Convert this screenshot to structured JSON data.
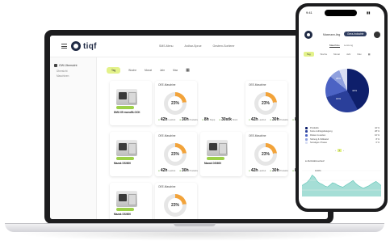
{
  "laptop": {
    "brand": "tiqf",
    "nav": [
      "SMS-Menu",
      "Ardhar-Sprue",
      "Gestern-Sortierer"
    ],
    "language": "DE",
    "sidebar": {
      "section": "GW-Übersicht",
      "items": [
        "Übersicht",
        "Maschinen"
      ]
    },
    "filters": [
      "Tag",
      "Woche",
      "Monat",
      "Jahr",
      "Max"
    ],
    "active_filter": "Tag",
    "cards": [
      {
        "kind": "machine",
        "title": "",
        "name": "DMU 65 monoBLOCK"
      },
      {
        "kind": "oee",
        "title": "OEE-Maschine",
        "percent": "23%",
        "name": "Mazak DS/600",
        "stats": [
          {
            "value": "42h",
            "unit": "Laufzeit"
          },
          {
            "value": "30h",
            "unit": "Produktiv"
          },
          {
            "value": "8h",
            "unit": "Stopp"
          },
          {
            "value": "30stk",
            "unit": "Stück"
          }
        ]
      },
      {
        "kind": "oee",
        "title": "OEE-Maschine",
        "percent": "23%",
        "name": "Mazak DS/600",
        "stats": [
          {
            "value": "42h",
            "unit": "Laufzeit"
          },
          {
            "value": "30h",
            "unit": "Produktiv"
          },
          {
            "value": "8h",
            "unit": "Stopp"
          },
          {
            "value": "30stk",
            "unit": "Stück"
          }
        ]
      },
      {
        "kind": "machine",
        "title": "",
        "name": "Mazak DS/600"
      },
      {
        "kind": "oee",
        "title": "OEE-Maschine",
        "percent": "23%",
        "name": "",
        "stats": [
          {
            "value": "42h",
            "unit": "Laufzeit"
          },
          {
            "value": "30h",
            "unit": "Produktiv"
          },
          {
            "value": "8h",
            "unit": "Stopp"
          },
          {
            "value": "30stk",
            "unit": "Stück"
          }
        ]
      },
      {
        "kind": "machine",
        "title": "",
        "name": "Mazak DS/600"
      },
      {
        "kind": "oee",
        "title": "OEE-Maschine",
        "percent": "23%",
        "name": "",
        "stats": [
          {
            "value": "42h",
            "unit": "Laufzeit"
          },
          {
            "value": "30h",
            "unit": "Produktiv"
          },
          {
            "value": "8h",
            "unit": "Stopp"
          },
          {
            "value": "30stk",
            "unit": "Stück"
          }
        ]
      },
      {
        "kind": "machine",
        "title": "",
        "name": "Mazak DS/600"
      },
      {
        "kind": "oee",
        "title": "OEE-Maschine",
        "percent": "23%",
        "name": "",
        "stats": []
      }
    ],
    "donut_level": 0.23,
    "colors": {
      "accent": "#e3f28a",
      "status_green": "#9dd14a",
      "donut_orange": "#f2a33a",
      "donut_track": "#e6e6e6",
      "navy": "#1f2a44"
    }
  },
  "phone": {
    "time": "9:41",
    "user": "Maxmann-ling",
    "pill": "Gera-Industrie",
    "tabs": [
      "Maschine",
      "Leistung"
    ],
    "active_tab": "Maschine",
    "filters": [
      "Tag",
      "Woche",
      "Monat",
      "Jahr",
      "Max"
    ],
    "active_filter": "Tag",
    "pie": {
      "slices": [
        {
          "label": "42%",
          "value": 42,
          "color": "#0e1f6b"
        },
        {
          "label": "28%",
          "value": 28,
          "color": "#2a3f9a"
        },
        {
          "label": "16%",
          "value": 16,
          "color": "#4c63c4"
        },
        {
          "label": "",
          "value": 8,
          "color": "#8fa0de"
        },
        {
          "label": "",
          "value": 6,
          "color": "#d9def3"
        }
      ]
    },
    "legend": [
      {
        "label": "Produktiv",
        "pct": "42 %",
        "color": "#0e1f6b"
      },
      {
        "label": "Keine Auftragsbelegung",
        "pct": "28 %",
        "color": "#2a3f9a"
      },
      {
        "label": "Rüsten & warten",
        "pct": "16 %",
        "color": "#4c63c4"
      },
      {
        "label": "Störung & Stillstand",
        "pct": "8 %",
        "color": "#8fa0de"
      },
      {
        "label": "Sonstiges / Pause",
        "pct": "6 %",
        "color": "#d9def3"
      }
    ],
    "pager": [
      "‹",
      "1",
      "›"
    ],
    "section_label": "Aktivitätsverlauf",
    "area_peak": "100%",
    "area_series": [
      40,
      46,
      52,
      62,
      78,
      70,
      55,
      48,
      44,
      38,
      35,
      42,
      50,
      47,
      41,
      37,
      34,
      40,
      46,
      52,
      58,
      48,
      40,
      35,
      30,
      34,
      38,
      44,
      50,
      55,
      48,
      40
    ],
    "area_color": "#5bc3b4"
  }
}
